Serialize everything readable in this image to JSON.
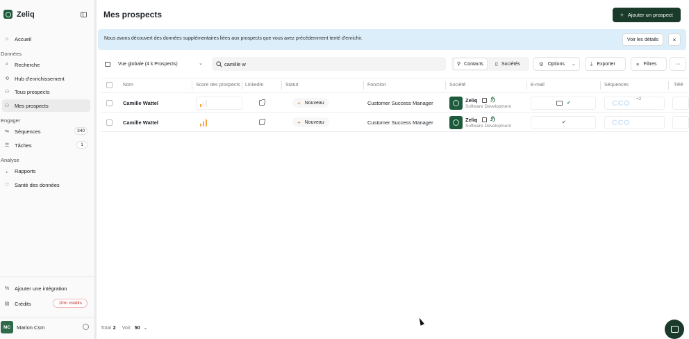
{
  "app": {
    "name": "Zeliq"
  },
  "sidebar": {
    "top_items": [
      {
        "label": "Accueil",
        "icon": "home-icon"
      }
    ],
    "sections": [
      {
        "title": "Données",
        "items": [
          {
            "label": "Recherche",
            "icon": "search-icon"
          },
          {
            "label": "Hub d'enrichissement",
            "icon": "hub-icon"
          },
          {
            "label": "Tous prospects",
            "icon": "users-icon"
          },
          {
            "label": "Mes prospects",
            "icon": "users-icon",
            "active": true
          }
        ]
      },
      {
        "title": "Engager",
        "items": [
          {
            "label": "Séquences",
            "icon": "sequence-icon",
            "count": "340"
          },
          {
            "label": "Tâches",
            "icon": "task-icon",
            "count": "1"
          }
        ]
      },
      {
        "title": "Analyse",
        "items": [
          {
            "label": "Rapports",
            "icon": "chart-icon"
          },
          {
            "label": "Santé des données",
            "icon": "heart-icon"
          }
        ]
      }
    ],
    "bottom": {
      "integration_label": "Ajouter une intégration",
      "credits_label": "Crédits",
      "credits_value": "10m crédits"
    },
    "user": {
      "initials": "MC",
      "name": "Marion Csm"
    }
  },
  "header": {
    "title": "Mes prospects",
    "add_button": "Ajouter un prospect"
  },
  "banner": {
    "text": "Nous avons découvert des données supplémentaires liées aux prospects que vous avez précédemment tenté d'enrichir.",
    "details_button": "Voir les détails",
    "close": "×"
  },
  "toolbar": {
    "view_label": "Vue globale (4 k Prospects)",
    "search_value": "camille w",
    "tab_contacts": "Contacts",
    "tab_companies": "Sociétés",
    "options_label": "Options",
    "export_label": "Exporter",
    "filters_label": "Filtres",
    "more": "···"
  },
  "table": {
    "columns": [
      "Nom",
      "Score des prospects",
      "LinkedIn",
      "Statut",
      "Fonction",
      "Société",
      "E-mail",
      "Séquences",
      "Télé"
    ],
    "rows": [
      {
        "name": "Camille Wattel",
        "score_level": 1,
        "status": "Nouveau",
        "function": "Customer Success Manager",
        "company": "Zeliq",
        "industry": "Software Development",
        "email_verified": true,
        "sequence_logo": "CCO",
        "sequence_more": "+2"
      },
      {
        "name": "Camille Wattel",
        "score_level": 3,
        "status": "Nouveau",
        "function": "Customer Success Manager",
        "company": "Zeliq",
        "industry": "Software Development",
        "email_verified": true,
        "sequence_logo": "CCO",
        "sequence_more": ""
      }
    ]
  },
  "footer": {
    "total_label": "Total",
    "total_value": "2",
    "per_page_label": "Voir:",
    "per_page_value": "50"
  },
  "colors": {
    "brand": "#1e5a3c",
    "primary_button": "#1a3a2a",
    "banner": "#dbeef9",
    "status_plus": "#d9731f",
    "score_bar": "#f2a33a"
  }
}
